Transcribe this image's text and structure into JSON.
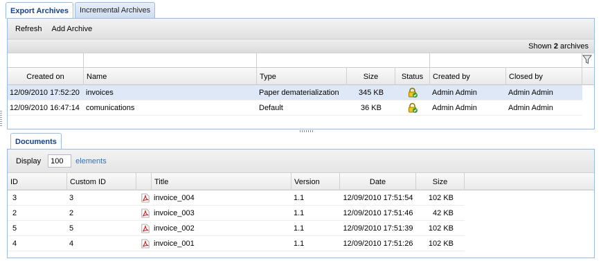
{
  "tabs": [
    {
      "label": "Export Archives",
      "active": true
    },
    {
      "label": "Incremental Archives",
      "active": false
    }
  ],
  "toolbar": {
    "refresh_label": "Refresh",
    "add_label": "Add Archive"
  },
  "info": {
    "prefix": "Shown ",
    "count": "2",
    "suffix": " archives"
  },
  "archives": {
    "columns": [
      "Created on",
      "Name",
      "Type",
      "Size",
      "Status",
      "Created by",
      "Closed by"
    ],
    "rows": [
      {
        "created_on": "12/09/2010 17:52:20",
        "name": "invoices",
        "type": "Paper dematerialization",
        "size": "345 KB",
        "status_icon": "lock-ok-icon",
        "created_by": "Admin Admin",
        "closed_by": "Admin Admin",
        "selected": true
      },
      {
        "created_on": "12/09/2010 16:47:14",
        "name": "comunications",
        "type": "Default",
        "size": "36 KB",
        "status_icon": "lock-ok-icon",
        "created_by": "Admin Admin",
        "closed_by": "Admin Admin",
        "selected": false
      }
    ]
  },
  "documents_tab": {
    "label": "Documents"
  },
  "display": {
    "label": "Display",
    "value": "100",
    "suffix": "elements"
  },
  "documents": {
    "columns": [
      "ID",
      "Custom ID",
      "",
      "Title",
      "Version",
      "Date",
      "Size"
    ],
    "rows": [
      {
        "id": "3",
        "custom_id": "3",
        "icon": "pdf-icon",
        "title": "invoice_004",
        "version": "1.1",
        "date": "12/09/2010 17:51:54",
        "size": "102 KB"
      },
      {
        "id": "2",
        "custom_id": "2",
        "icon": "pdf-icon",
        "title": "invoice_003",
        "version": "1.1",
        "date": "12/09/2010 17:51:46",
        "size": "42 KB"
      },
      {
        "id": "5",
        "custom_id": "5",
        "icon": "pdf-icon",
        "title": "invoice_002",
        "version": "1.1",
        "date": "12/09/2010 17:51:39",
        "size": "102 KB"
      },
      {
        "id": "4",
        "custom_id": "4",
        "icon": "pdf-icon",
        "title": "invoice_001",
        "version": "1.1",
        "date": "12/09/2010 17:51:26",
        "size": "102 KB"
      }
    ]
  },
  "colors": {
    "border": "#99bbe8",
    "selected_row": "#dfe8f6",
    "link": "#3a6fb0",
    "pdf_red": "#cc2222"
  }
}
